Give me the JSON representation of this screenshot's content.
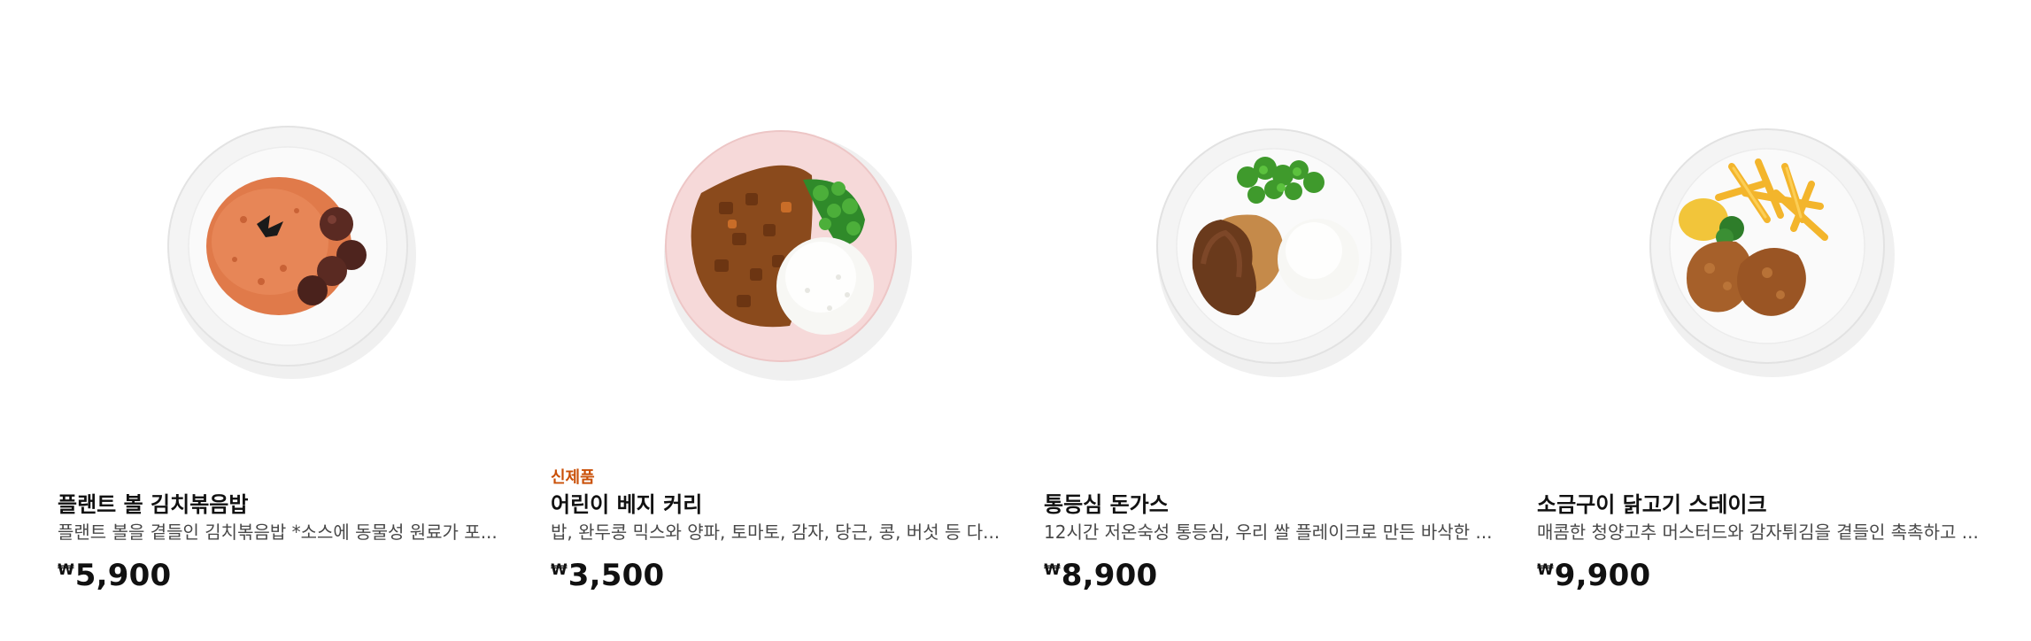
{
  "products": [
    {
      "badge": "",
      "title": "플랜트 볼 김치볶음밥",
      "description": "플랜트 볼을 곁들인 김치볶음밥 *소스에 동물성 원료가 포...",
      "currency": "₩",
      "price": "5,900",
      "image_icon": "kimchi-fried-rice-plate"
    },
    {
      "badge": "신제품",
      "title": "어린이 베지 커리",
      "description": "밥, 완두콩 믹스와 양파, 토마토, 감자, 당근, 콩, 버섯 등 다...",
      "currency": "₩",
      "price": "3,500",
      "image_icon": "veggie-curry-plate"
    },
    {
      "badge": "",
      "title": "통등심 돈가스",
      "description": "12시간 저온숙성 통등심, 우리 쌀 플레이크로 만든 바삭한 ...",
      "currency": "₩",
      "price": "8,900",
      "image_icon": "pork-cutlet-plate"
    },
    {
      "badge": "",
      "title": "소금구이 닭고기 스테이크",
      "description": "매콤한 청양고추 머스터드와 감자튀김을 곁들인 촉촉하고 ...",
      "currency": "₩",
      "price": "9,900",
      "image_icon": "chicken-steak-plate"
    }
  ],
  "colors": {
    "badge": "#ca5008",
    "text": "#111111",
    "muted": "#484848",
    "plate": "#f2f2f2"
  }
}
